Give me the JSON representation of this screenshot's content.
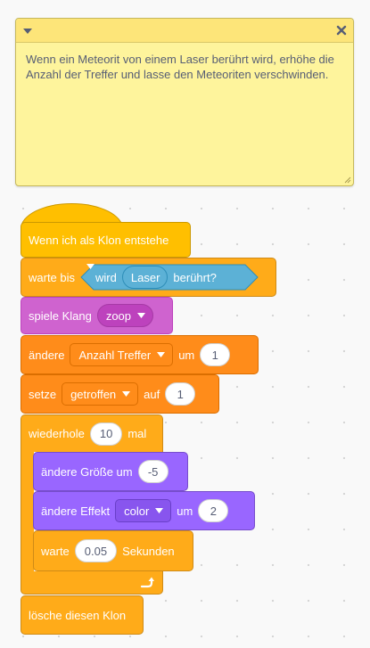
{
  "comment": {
    "text": "Wenn ein Meteorit von einem Laser berührt wird, erhöhe die Anzahl der Treffer und lasse den Meteoriten verschwinden."
  },
  "blocks": {
    "hat": {
      "label": "Wenn ich als Klon entstehe"
    },
    "wait_until": {
      "label": "warte bis",
      "sensing_pre": "wird",
      "sensing_target": "Laser",
      "sensing_post": "berührt?"
    },
    "play_sound": {
      "label": "spiele Klang",
      "sound": "zoop"
    },
    "change_var": {
      "pre": "ändere",
      "variable": "Anzahl Treffer",
      "mid": "um",
      "value": "1"
    },
    "set_var": {
      "pre": "setze",
      "variable": "getroffen",
      "mid": "auf",
      "value": "1"
    },
    "repeat": {
      "pre": "wiederhole",
      "times": "10",
      "post": "mal"
    },
    "change_size": {
      "label": "ändere Größe um",
      "value": "-5"
    },
    "change_effect": {
      "pre": "ändere Effekt",
      "effect": "color",
      "mid": "um",
      "value": "2"
    },
    "wait": {
      "pre": "warte",
      "value": "0.05",
      "post": "Sekunden"
    },
    "delete_clone": {
      "label": "lösche diesen Klon"
    }
  },
  "colors": {
    "control": "#ffab19",
    "events": "#ffbf00",
    "variables": "#ff8c1a",
    "looks": "#9966ff",
    "sound": "#cf63cf",
    "sensing": "#5cb1d6",
    "note": "#fef49c"
  }
}
